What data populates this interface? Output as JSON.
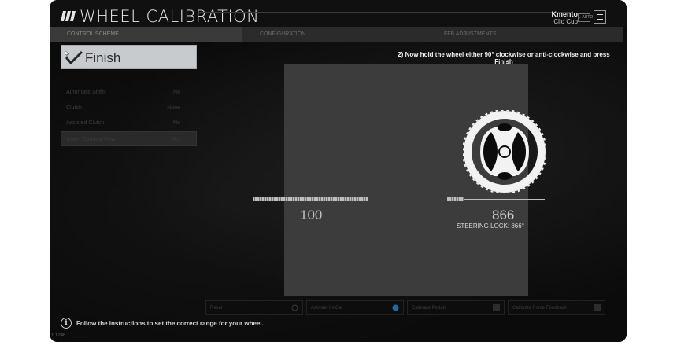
{
  "window": {
    "title": "WHEEL CALIBRATION"
  },
  "profile": {
    "name": "Kmento",
    "car": "Clio Cup",
    "badge": "L·AUTO"
  },
  "tabs": [
    {
      "label": "CONTROL SCHEME",
      "active": true
    },
    {
      "label": "CONFIGURATION",
      "active": false
    },
    {
      "label": "FFB ADJUSTMENTS",
      "active": false
    }
  ],
  "finish_button": {
    "label": "Finish"
  },
  "settings": [
    {
      "label": "Automatic Shifts",
      "value": "No"
    },
    {
      "label": "Clutch",
      "value": "None"
    },
    {
      "label": "Assisted Clutch",
      "value": "No"
    },
    {
      "label": "Invert Camera View",
      "value": "Yes"
    }
  ],
  "instruction": "2) Now hold the wheel either 90° clockwise or anti-clockwise and press Finish",
  "calibration": {
    "left_value": "100",
    "left_fraction": 1.0,
    "right_value": "866",
    "right_fraction": 0.18,
    "steering_lock": "STEERING LOCK: 866°"
  },
  "bottom_controls": [
    {
      "label": "Reset",
      "icon": "reset-icon"
    },
    {
      "label": "Activate IN-Car",
      "icon": "toggle-icon"
    },
    {
      "label": "Calibrate Pedals",
      "icon": "checkbox-icon"
    },
    {
      "label": "Calibrate Force Feedback",
      "icon": "checkbox-icon"
    }
  ],
  "footer": {
    "info": "Follow the instructions to set the correct range for your wheel.",
    "version": "1.1246"
  },
  "colors": {
    "background": "#0b0b0b",
    "finish_bg": "#c7cbce",
    "panel": "#3c3c3c"
  }
}
